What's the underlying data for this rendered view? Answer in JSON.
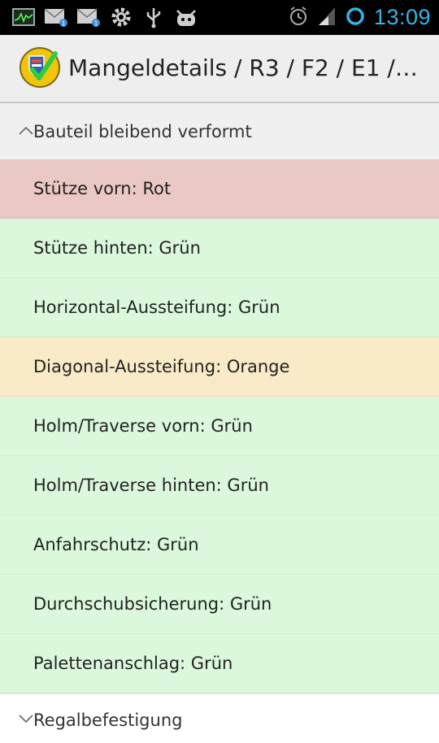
{
  "status_bar": {
    "time": "13:09",
    "icons_left": [
      "activity-monitor-icon",
      "mail-notification-icon",
      "mail-notification-icon",
      "settings-gear-icon",
      "usb-icon",
      "android-debug-icon"
    ],
    "icons_right": [
      "alarm-clock-icon",
      "signal-strength-icon",
      "sync-circle-icon"
    ],
    "accent_color": "#33b5e5"
  },
  "action_bar": {
    "title": "Mangeldetails / R3 / F2 / E1 /…",
    "logo_icon": "shield-checkmark-logo"
  },
  "groups": [
    {
      "label": "Bauteil bleibend verformt",
      "expanded": true,
      "items": [
        {
          "label": "Stütze vorn: Rot",
          "status": "red"
        },
        {
          "label": "Stütze hinten: Grün",
          "status": "green"
        },
        {
          "label": "Horizontal-Aussteifung: Grün",
          "status": "green"
        },
        {
          "label": "Diagonal-Aussteifung: Orange",
          "status": "orange"
        },
        {
          "label": "Holm/Traverse vorn: Grün",
          "status": "green"
        },
        {
          "label": "Holm/Traverse hinten: Grün",
          "status": "green"
        },
        {
          "label": "Anfahrschutz: Grün",
          "status": "green"
        },
        {
          "label": "Durchschubsicherung: Grün",
          "status": "green"
        },
        {
          "label": "Palettenanschlag: Grün",
          "status": "green"
        }
      ]
    },
    {
      "label": "Regalbefestigung",
      "expanded": false,
      "items": []
    }
  ],
  "status_colors": {
    "red": "#eac8c3",
    "green": "#dbf8dc",
    "orange": "#f9ebc8"
  }
}
